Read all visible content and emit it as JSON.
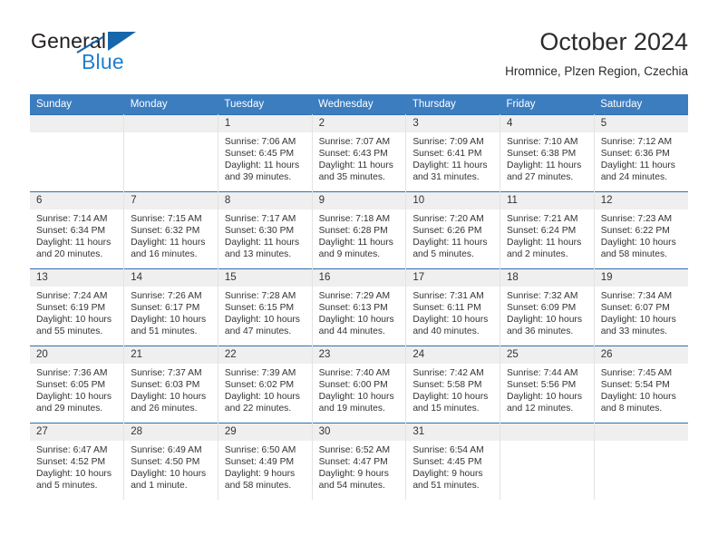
{
  "brand": {
    "name_part1": "General",
    "name_part2": "Blue",
    "logo_icon": "triangle-logo-icon"
  },
  "header": {
    "title": "October 2024",
    "subtitle": "Hromnice, Plzen Region, Czechia"
  },
  "colors": {
    "header_bar": "#3c7dc0",
    "row_divider": "#2f6fb0",
    "daynum_band": "#efefef",
    "brand_blue": "#1f7fd0",
    "brand_dark": "#231f20"
  },
  "calendar": {
    "weekday_headers": [
      "Sunday",
      "Monday",
      "Tuesday",
      "Wednesday",
      "Thursday",
      "Friday",
      "Saturday"
    ],
    "weeks": [
      [
        {
          "day": "",
          "empty": true,
          "sunrise": "",
          "sunset": "",
          "daylight_line1": "",
          "daylight_line2": ""
        },
        {
          "day": "",
          "empty": true,
          "sunrise": "",
          "sunset": "",
          "daylight_line1": "",
          "daylight_line2": ""
        },
        {
          "day": "1",
          "empty": false,
          "sunrise": "Sunrise: 7:06 AM",
          "sunset": "Sunset: 6:45 PM",
          "daylight_line1": "Daylight: 11 hours",
          "daylight_line2": "and 39 minutes."
        },
        {
          "day": "2",
          "empty": false,
          "sunrise": "Sunrise: 7:07 AM",
          "sunset": "Sunset: 6:43 PM",
          "daylight_line1": "Daylight: 11 hours",
          "daylight_line2": "and 35 minutes."
        },
        {
          "day": "3",
          "empty": false,
          "sunrise": "Sunrise: 7:09 AM",
          "sunset": "Sunset: 6:41 PM",
          "daylight_line1": "Daylight: 11 hours",
          "daylight_line2": "and 31 minutes."
        },
        {
          "day": "4",
          "empty": false,
          "sunrise": "Sunrise: 7:10 AM",
          "sunset": "Sunset: 6:38 PM",
          "daylight_line1": "Daylight: 11 hours",
          "daylight_line2": "and 27 minutes."
        },
        {
          "day": "5",
          "empty": false,
          "sunrise": "Sunrise: 7:12 AM",
          "sunset": "Sunset: 6:36 PM",
          "daylight_line1": "Daylight: 11 hours",
          "daylight_line2": "and 24 minutes."
        }
      ],
      [
        {
          "day": "6",
          "empty": false,
          "sunrise": "Sunrise: 7:14 AM",
          "sunset": "Sunset: 6:34 PM",
          "daylight_line1": "Daylight: 11 hours",
          "daylight_line2": "and 20 minutes."
        },
        {
          "day": "7",
          "empty": false,
          "sunrise": "Sunrise: 7:15 AM",
          "sunset": "Sunset: 6:32 PM",
          "daylight_line1": "Daylight: 11 hours",
          "daylight_line2": "and 16 minutes."
        },
        {
          "day": "8",
          "empty": false,
          "sunrise": "Sunrise: 7:17 AM",
          "sunset": "Sunset: 6:30 PM",
          "daylight_line1": "Daylight: 11 hours",
          "daylight_line2": "and 13 minutes."
        },
        {
          "day": "9",
          "empty": false,
          "sunrise": "Sunrise: 7:18 AM",
          "sunset": "Sunset: 6:28 PM",
          "daylight_line1": "Daylight: 11 hours",
          "daylight_line2": "and 9 minutes."
        },
        {
          "day": "10",
          "empty": false,
          "sunrise": "Sunrise: 7:20 AM",
          "sunset": "Sunset: 6:26 PM",
          "daylight_line1": "Daylight: 11 hours",
          "daylight_line2": "and 5 minutes."
        },
        {
          "day": "11",
          "empty": false,
          "sunrise": "Sunrise: 7:21 AM",
          "sunset": "Sunset: 6:24 PM",
          "daylight_line1": "Daylight: 11 hours",
          "daylight_line2": "and 2 minutes."
        },
        {
          "day": "12",
          "empty": false,
          "sunrise": "Sunrise: 7:23 AM",
          "sunset": "Sunset: 6:22 PM",
          "daylight_line1": "Daylight: 10 hours",
          "daylight_line2": "and 58 minutes."
        }
      ],
      [
        {
          "day": "13",
          "empty": false,
          "sunrise": "Sunrise: 7:24 AM",
          "sunset": "Sunset: 6:19 PM",
          "daylight_line1": "Daylight: 10 hours",
          "daylight_line2": "and 55 minutes."
        },
        {
          "day": "14",
          "empty": false,
          "sunrise": "Sunrise: 7:26 AM",
          "sunset": "Sunset: 6:17 PM",
          "daylight_line1": "Daylight: 10 hours",
          "daylight_line2": "and 51 minutes."
        },
        {
          "day": "15",
          "empty": false,
          "sunrise": "Sunrise: 7:28 AM",
          "sunset": "Sunset: 6:15 PM",
          "daylight_line1": "Daylight: 10 hours",
          "daylight_line2": "and 47 minutes."
        },
        {
          "day": "16",
          "empty": false,
          "sunrise": "Sunrise: 7:29 AM",
          "sunset": "Sunset: 6:13 PM",
          "daylight_line1": "Daylight: 10 hours",
          "daylight_line2": "and 44 minutes."
        },
        {
          "day": "17",
          "empty": false,
          "sunrise": "Sunrise: 7:31 AM",
          "sunset": "Sunset: 6:11 PM",
          "daylight_line1": "Daylight: 10 hours",
          "daylight_line2": "and 40 minutes."
        },
        {
          "day": "18",
          "empty": false,
          "sunrise": "Sunrise: 7:32 AM",
          "sunset": "Sunset: 6:09 PM",
          "daylight_line1": "Daylight: 10 hours",
          "daylight_line2": "and 36 minutes."
        },
        {
          "day": "19",
          "empty": false,
          "sunrise": "Sunrise: 7:34 AM",
          "sunset": "Sunset: 6:07 PM",
          "daylight_line1": "Daylight: 10 hours",
          "daylight_line2": "and 33 minutes."
        }
      ],
      [
        {
          "day": "20",
          "empty": false,
          "sunrise": "Sunrise: 7:36 AM",
          "sunset": "Sunset: 6:05 PM",
          "daylight_line1": "Daylight: 10 hours",
          "daylight_line2": "and 29 minutes."
        },
        {
          "day": "21",
          "empty": false,
          "sunrise": "Sunrise: 7:37 AM",
          "sunset": "Sunset: 6:03 PM",
          "daylight_line1": "Daylight: 10 hours",
          "daylight_line2": "and 26 minutes."
        },
        {
          "day": "22",
          "empty": false,
          "sunrise": "Sunrise: 7:39 AM",
          "sunset": "Sunset: 6:02 PM",
          "daylight_line1": "Daylight: 10 hours",
          "daylight_line2": "and 22 minutes."
        },
        {
          "day": "23",
          "empty": false,
          "sunrise": "Sunrise: 7:40 AM",
          "sunset": "Sunset: 6:00 PM",
          "daylight_line1": "Daylight: 10 hours",
          "daylight_line2": "and 19 minutes."
        },
        {
          "day": "24",
          "empty": false,
          "sunrise": "Sunrise: 7:42 AM",
          "sunset": "Sunset: 5:58 PM",
          "daylight_line1": "Daylight: 10 hours",
          "daylight_line2": "and 15 minutes."
        },
        {
          "day": "25",
          "empty": false,
          "sunrise": "Sunrise: 7:44 AM",
          "sunset": "Sunset: 5:56 PM",
          "daylight_line1": "Daylight: 10 hours",
          "daylight_line2": "and 12 minutes."
        },
        {
          "day": "26",
          "empty": false,
          "sunrise": "Sunrise: 7:45 AM",
          "sunset": "Sunset: 5:54 PM",
          "daylight_line1": "Daylight: 10 hours",
          "daylight_line2": "and 8 minutes."
        }
      ],
      [
        {
          "day": "27",
          "empty": false,
          "sunrise": "Sunrise: 6:47 AM",
          "sunset": "Sunset: 4:52 PM",
          "daylight_line1": "Daylight: 10 hours",
          "daylight_line2": "and 5 minutes."
        },
        {
          "day": "28",
          "empty": false,
          "sunrise": "Sunrise: 6:49 AM",
          "sunset": "Sunset: 4:50 PM",
          "daylight_line1": "Daylight: 10 hours",
          "daylight_line2": "and 1 minute."
        },
        {
          "day": "29",
          "empty": false,
          "sunrise": "Sunrise: 6:50 AM",
          "sunset": "Sunset: 4:49 PM",
          "daylight_line1": "Daylight: 9 hours",
          "daylight_line2": "and 58 minutes."
        },
        {
          "day": "30",
          "empty": false,
          "sunrise": "Sunrise: 6:52 AM",
          "sunset": "Sunset: 4:47 PM",
          "daylight_line1": "Daylight: 9 hours",
          "daylight_line2": "and 54 minutes."
        },
        {
          "day": "31",
          "empty": false,
          "sunrise": "Sunrise: 6:54 AM",
          "sunset": "Sunset: 4:45 PM",
          "daylight_line1": "Daylight: 9 hours",
          "daylight_line2": "and 51 minutes."
        },
        {
          "day": "",
          "empty": true,
          "sunrise": "",
          "sunset": "",
          "daylight_line1": "",
          "daylight_line2": ""
        },
        {
          "day": "",
          "empty": true,
          "sunrise": "",
          "sunset": "",
          "daylight_line1": "",
          "daylight_line2": ""
        }
      ]
    ]
  }
}
